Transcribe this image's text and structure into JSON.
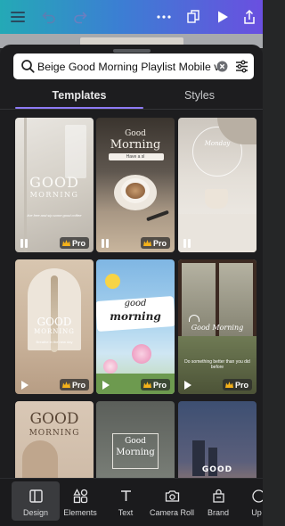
{
  "search": {
    "value": "Beige Good Morning Playlist Mobile video"
  },
  "tabs": [
    {
      "label": "Templates",
      "active": true
    },
    {
      "label": "Styles",
      "active": false
    }
  ],
  "templates": [
    {
      "title": "GOOD",
      "subtitle": "MORNING",
      "caption": "live free and sip some good coffee",
      "badge": "Pro",
      "control": "pause"
    },
    {
      "title": "Good",
      "subtitle": "Morning",
      "caption": "Have a sl",
      "badge": "Pro",
      "control": "pause"
    },
    {
      "title": "Monday",
      "badge": "",
      "control": "pause"
    },
    {
      "title": "GOOD",
      "subtitle": "MORNING",
      "caption": "Breathe in the new day",
      "badge": "Pro",
      "control": "play"
    },
    {
      "title": "good",
      "subtitle": "morning",
      "badge": "Pro",
      "control": "play"
    },
    {
      "title": "Good Morning",
      "caption": "Do something better than you did before",
      "badge": "Pro",
      "control": "play"
    },
    {
      "title": "GOOD",
      "subtitle": "MORNING",
      "badge": "",
      "control": ""
    },
    {
      "title": "Good",
      "subtitle": "Morning",
      "badge": "",
      "control": ""
    },
    {
      "title": "GOOD",
      "badge": "",
      "control": ""
    }
  ],
  "bottom_nav": [
    {
      "label": "Design",
      "icon": "layout-icon",
      "active": true
    },
    {
      "label": "Elements",
      "icon": "shapes-icon",
      "active": false
    },
    {
      "label": "Text",
      "icon": "text-icon",
      "active": false
    },
    {
      "label": "Camera Roll",
      "icon": "camera-icon",
      "active": false
    },
    {
      "label": "Brand",
      "icon": "brand-icon",
      "active": false
    },
    {
      "label": "Up",
      "icon": "upload-icon",
      "active": false
    }
  ],
  "colors": {
    "toolbar_start": "#24a9b6",
    "toolbar_end": "#6a4fe0",
    "accent": "#8e7bf5",
    "sheet_bg": "#1d1d1f"
  }
}
